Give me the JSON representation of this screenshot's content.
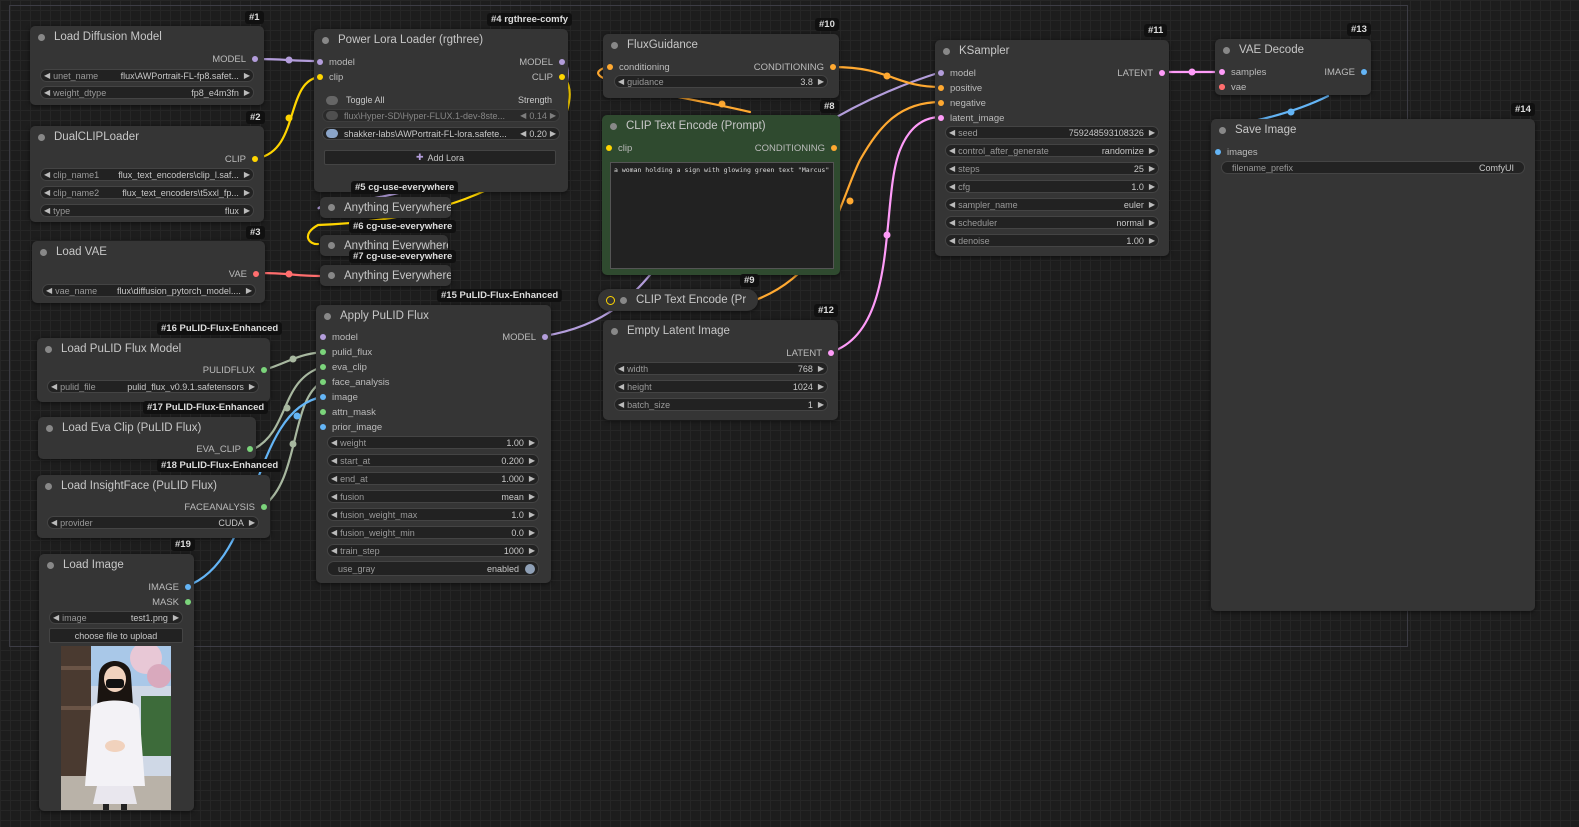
{
  "colors": {
    "model": "#b39ddb",
    "clip": "#ffd500",
    "vae": "#ff6e6e",
    "conditioning": "#ffa931",
    "latent": "#ff9cf9",
    "image": "#64b5f6",
    "pulid": "#7bd47b",
    "background": "#1d1d1d",
    "node": "#353535"
  },
  "nodes": {
    "n1": {
      "badge": "#1",
      "title": "Load Diffusion Model",
      "outputs": [
        "MODEL"
      ],
      "widgets": [
        {
          "label": "unet_name",
          "value": "flux\\AWPortrait-FL-fp8.safet..."
        },
        {
          "label": "weight_dtype",
          "value": "fp8_e4m3fn"
        }
      ]
    },
    "n2": {
      "badge": "#2",
      "title": "DualCLIPLoader",
      "outputs": [
        "CLIP"
      ],
      "widgets": [
        {
          "label": "clip_name1",
          "value": "flux_text_encoders\\clip_l.saf..."
        },
        {
          "label": "clip_name2",
          "value": "flux_text_encoders\\t5xxl_fp..."
        },
        {
          "label": "type",
          "value": "flux"
        }
      ]
    },
    "n3": {
      "badge": "#3",
      "title": "Load VAE",
      "outputs": [
        "VAE"
      ],
      "widgets": [
        {
          "label": "vae_name",
          "value": "flux\\diffusion_pytorch_model...."
        }
      ]
    },
    "n4": {
      "badge": "#4 rgthree-comfy",
      "title": "Power Lora Loader (rgthree)",
      "inputs": [
        "model",
        "clip"
      ],
      "outputs": [
        "MODEL",
        "CLIP"
      ],
      "toggle_all": "Toggle All",
      "strength_header": "Strength",
      "loras": [
        {
          "name": "flux\\Hyper-SD\\Hyper-FLUX.1-dev-8ste...",
          "strength": "0.14"
        },
        {
          "name": "shakker-labs\\AWPortrait-FL-lora.safete...",
          "strength": "0.20"
        }
      ],
      "add_lora": "Add Lora"
    },
    "n5": {
      "badge": "#5 cg-use-everywhere",
      "title": "Anything Everywhere"
    },
    "n6": {
      "badge": "#6 cg-use-everywhere",
      "title": "Anything Everywhere"
    },
    "n7": {
      "badge": "#7 cg-use-everywhere",
      "title": "Anything Everywhere"
    },
    "n8": {
      "badge": "#8",
      "title": "CLIP Text Encode (Prompt)",
      "inputs": [
        "clip"
      ],
      "outputs": [
        "CONDITIONING"
      ],
      "text": "a woman holding a sign with glowing green text \"Marcus\""
    },
    "n9": {
      "badge": "#9",
      "title": "CLIP Text Encode (Pr"
    },
    "n10": {
      "badge": "#10",
      "title": "FluxGuidance",
      "inputs": [
        "conditioning"
      ],
      "outputs": [
        "CONDITIONING"
      ],
      "widgets": [
        {
          "label": "guidance",
          "value": "3.8"
        }
      ]
    },
    "n11": {
      "badge": "#11",
      "title": "KSampler",
      "inputs": [
        "model",
        "positive",
        "negative",
        "latent_image"
      ],
      "outputs": [
        "LATENT"
      ],
      "widgets": [
        {
          "label": "seed",
          "value": "759248593108326"
        },
        {
          "label": "control_after_generate",
          "value": "randomize"
        },
        {
          "label": "steps",
          "value": "25"
        },
        {
          "label": "cfg",
          "value": "1.0"
        },
        {
          "label": "sampler_name",
          "value": "euler"
        },
        {
          "label": "scheduler",
          "value": "normal"
        },
        {
          "label": "denoise",
          "value": "1.00"
        }
      ]
    },
    "n12": {
      "badge": "#12",
      "title": "Empty Latent Image",
      "outputs": [
        "LATENT"
      ],
      "widgets": [
        {
          "label": "width",
          "value": "768"
        },
        {
          "label": "height",
          "value": "1024"
        },
        {
          "label": "batch_size",
          "value": "1"
        }
      ]
    },
    "n13": {
      "badge": "#13",
      "title": "VAE Decode",
      "inputs": [
        "samples",
        "vae"
      ],
      "outputs": [
        "IMAGE"
      ]
    },
    "n14": {
      "badge": "#14",
      "title": "Save Image",
      "inputs": [
        "images"
      ],
      "widgets": [
        {
          "label": "filename_prefix",
          "value": "ComfyUI"
        }
      ]
    },
    "n15": {
      "badge": "#15 PuLID-Flux-Enhanced",
      "title": "Apply PuLID Flux",
      "inputs": [
        "model",
        "pulid_flux",
        "eva_clip",
        "face_analysis",
        "image",
        "attn_mask",
        "prior_image"
      ],
      "outputs": [
        "MODEL"
      ],
      "widgets": [
        {
          "label": "weight",
          "value": "1.00"
        },
        {
          "label": "start_at",
          "value": "0.200"
        },
        {
          "label": "end_at",
          "value": "1.000"
        },
        {
          "label": "fusion",
          "value": "mean"
        },
        {
          "label": "fusion_weight_max",
          "value": "1.0"
        },
        {
          "label": "fusion_weight_min",
          "value": "0.0"
        },
        {
          "label": "train_step",
          "value": "1000"
        }
      ],
      "toggle": {
        "label": "use_gray",
        "value": "enabled"
      }
    },
    "n16": {
      "badge": "#16 PuLID-Flux-Enhanced",
      "title": "Load PuLID Flux Model",
      "outputs": [
        "PULIDFLUX"
      ],
      "widgets": [
        {
          "label": "pulid_file",
          "value": "pulid_flux_v0.9.1.safetensors"
        }
      ]
    },
    "n17": {
      "badge": "#17 PuLID-Flux-Enhanced",
      "title": "Load Eva Clip (PuLID Flux)",
      "outputs": [
        "EVA_CLIP"
      ]
    },
    "n18": {
      "badge": "#18 PuLID-Flux-Enhanced",
      "title": "Load InsightFace (PuLID Flux)",
      "outputs": [
        "FACEANALYSIS"
      ],
      "widgets": [
        {
          "label": "provider",
          "value": "CUDA"
        }
      ]
    },
    "n19": {
      "badge": "#19",
      "title": "Load Image",
      "outputs": [
        "IMAGE",
        "MASK"
      ],
      "widgets": [
        {
          "label": "image",
          "value": "test1.png"
        }
      ],
      "upload_button": "choose file to upload"
    }
  }
}
